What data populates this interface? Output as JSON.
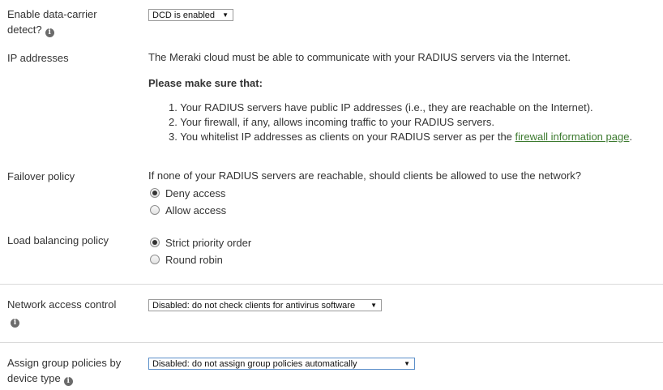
{
  "dcd": {
    "label_line1": "Enable data-carrier",
    "label_line2": "detect?",
    "info_glyph": "i",
    "select_value": "DCD is enabled"
  },
  "ip": {
    "label": "IP addresses",
    "intro": "The Meraki cloud must be able to communicate with your RADIUS servers via the Internet.",
    "heading": "Please make sure that:",
    "items": [
      "1. Your RADIUS servers have public IP addresses (i.e., they are reachable on the Internet).",
      "2. Your firewall, if any, allows incoming traffic to your RADIUS servers.",
      "3. You whitelist IP addresses as clients on your RADIUS server as per the "
    ],
    "link_text": "firewall information page",
    "link_suffix": "."
  },
  "failover": {
    "label": "Failover policy",
    "question": "If none of your RADIUS servers are reachable, should clients be allowed to use the network?",
    "options": [
      "Deny access",
      "Allow access"
    ],
    "selected": "Deny access"
  },
  "load_balancing": {
    "label": "Load balancing policy",
    "options": [
      "Strict priority order",
      "Round robin"
    ],
    "selected": "Strict priority order"
  },
  "nac": {
    "label": "Network access control",
    "info_glyph": "i",
    "select_value": "Disabled: do not check clients for antivirus software"
  },
  "group_policies": {
    "label_line1": "Assign group policies by",
    "label_line2": "device type",
    "info_glyph": "i",
    "select_value": "Disabled: do not assign group policies automatically"
  },
  "icons": {
    "dropdown": "▼"
  },
  "colors": {
    "link": "#3c7a2f",
    "focus_border": "#5b8fc9"
  }
}
